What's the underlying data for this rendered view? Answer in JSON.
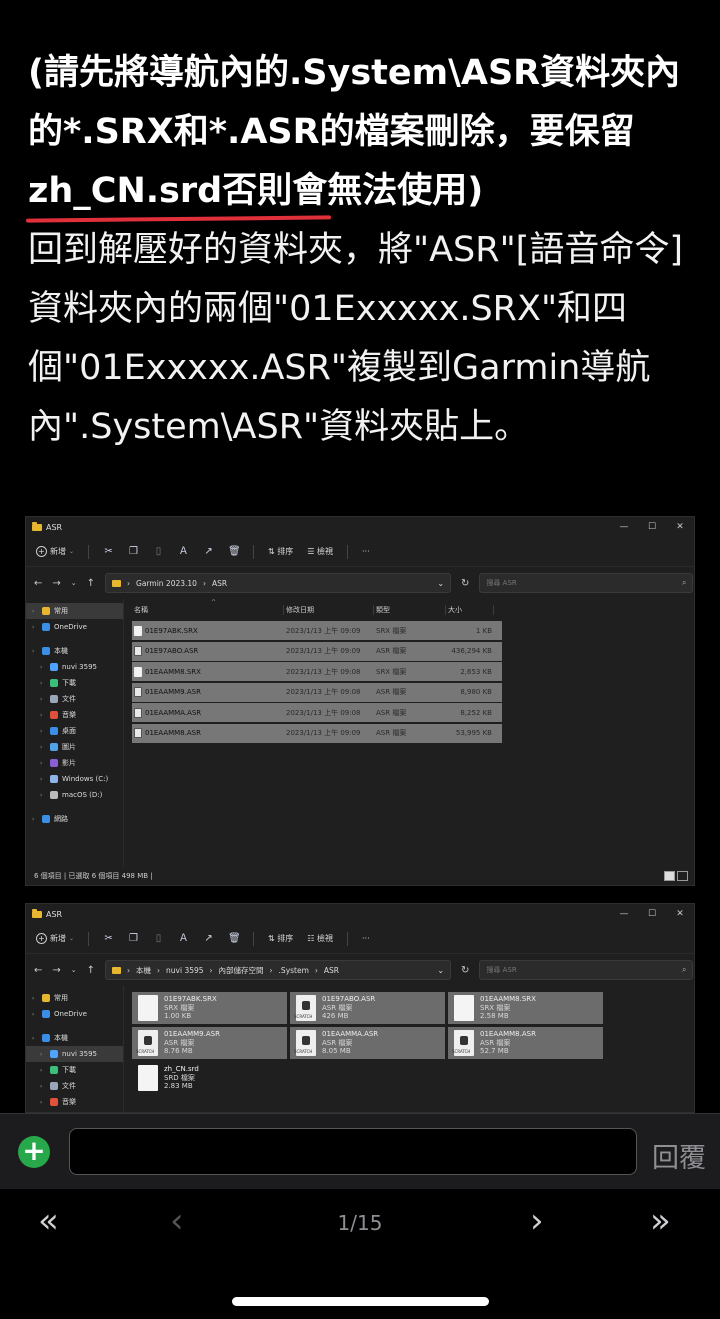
{
  "post": {
    "bold_part1": "(請先將導航內的.System\\ASR資料夾內的*.SRX和*.ASR的檔案刪除，要保留",
    "bold_underlined": "zh_CN.srd否則會",
    "bold_part2": "無法使用)",
    "body": "回到解壓好的資料夾，將\"ASR\"[語音命令]資料夾內的兩個\"01Exxxxx.SRX\"和四個\"01Exxxxx.ASR\"複製到Garmin導航內\".System\\ASR\"資料夾貼上。"
  },
  "explorer1": {
    "window_title": "ASR",
    "win_buttons": [
      "—",
      "☐",
      "✕"
    ],
    "cmd": {
      "new": "新增",
      "sort": "排序",
      "view": "檢視",
      "more": "···"
    },
    "breadcrumb": [
      "Garmin 2023.10",
      "ASR"
    ],
    "search_placeholder": "搜尋 ASR",
    "nav": [
      {
        "label": "常用",
        "color": "#e8b730",
        "level": 1,
        "selected": true
      },
      {
        "label": "OneDrive",
        "color": "#3b8ee6",
        "level": 1
      },
      {
        "label": "本機",
        "color": "#3b8ee6",
        "level": 1
      },
      {
        "label": "nuvi 3595",
        "color": "#4da3ff",
        "level": 2
      },
      {
        "label": "下載",
        "color": "#3bbf7a",
        "level": 2
      },
      {
        "label": "文件",
        "color": "#9aa7b8",
        "level": 2
      },
      {
        "label": "音樂",
        "color": "#e0503a",
        "level": 2
      },
      {
        "label": "桌面",
        "color": "#3b8ee6",
        "level": 2
      },
      {
        "label": "圖片",
        "color": "#4fa3e8",
        "level": 2
      },
      {
        "label": "影片",
        "color": "#8a5fd6",
        "level": 2
      },
      {
        "label": "Windows (C:)",
        "color": "#8fb5e8",
        "level": 2
      },
      {
        "label": "macOS (D:)",
        "color": "#bbbbbb",
        "level": 2
      },
      {
        "label": "網路",
        "color": "#3b8ee6",
        "level": 1
      }
    ],
    "columns": {
      "name": "名稱",
      "date": "修改日期",
      "type": "類型",
      "size": "大小"
    },
    "rows": [
      {
        "name": "01E97ABK.SRX",
        "date": "2023/1/13 上午 09:09",
        "type": "SRX 檔案",
        "size": "1 KB"
      },
      {
        "name": "01E97ABO.ASR",
        "date": "2023/1/13 上午 09:09",
        "type": "ASR 檔案",
        "size": "436,294 KB"
      },
      {
        "name": "01EAAMM8.SRX",
        "date": "2023/1/13 上午 09:08",
        "type": "SRX 檔案",
        "size": "2,653 KB"
      },
      {
        "name": "01EAAMM9.ASR",
        "date": "2023/1/13 上午 09:08",
        "type": "ASR 檔案",
        "size": "8,980 KB"
      },
      {
        "name": "01EAAMMA.ASR",
        "date": "2023/1/13 上午 09:08",
        "type": "ASR 檔案",
        "size": "8,252 KB"
      },
      {
        "name": "01EAAMM8.ASR",
        "date": "2023/1/13 上午 09:09",
        "type": "ASR 檔案",
        "size": "53,995 KB"
      }
    ],
    "status": "6 個項目  |  已選取 6 個項目 498 MB  |"
  },
  "explorer2": {
    "window_title": "ASR",
    "cmd": {
      "new": "新增",
      "sort": "排序",
      "view": "檢視",
      "more": "···"
    },
    "breadcrumb": [
      "本機",
      "nuvi 3595",
      "內部儲存空間",
      ".System",
      "ASR"
    ],
    "search_placeholder": "搜尋 ASR",
    "nav": [
      {
        "label": "常用",
        "color": "#e8b730",
        "level": 1
      },
      {
        "label": "OneDrive",
        "color": "#3b8ee6",
        "level": 1
      },
      {
        "label": "本機",
        "color": "#3b8ee6",
        "level": 1
      },
      {
        "label": "nuvi 3595",
        "color": "#4da3ff",
        "level": 2,
        "selected": true
      },
      {
        "label": "下載",
        "color": "#3bbf7a",
        "level": 2
      },
      {
        "label": "文件",
        "color": "#9aa7b8",
        "level": 2
      },
      {
        "label": "音樂",
        "color": "#e0503a",
        "level": 2
      }
    ],
    "tiles": [
      {
        "name": "01E97ABK.SRX",
        "type": "SRX 檔案",
        "size": "1.00 KB",
        "icon": "doc",
        "selected": true
      },
      {
        "name": "01E97ABO.ASR",
        "type": "ASR 檔案",
        "size": "426 MB",
        "icon": "scratch",
        "selected": true
      },
      {
        "name": "01EAAMM8.SRX",
        "type": "SRX 檔案",
        "size": "2.58 MB",
        "icon": "doc",
        "selected": true
      },
      {
        "name": "01EAAMM9.ASR",
        "type": "ASR 檔案",
        "size": "8.76 MB",
        "icon": "scratch",
        "selected": true
      },
      {
        "name": "01EAAMMA.ASR",
        "type": "ASR 檔案",
        "size": "8.05 MB",
        "icon": "scratch",
        "selected": true
      },
      {
        "name": "01EAAMM8.ASR",
        "type": "ASR 檔案",
        "size": "52.7 MB",
        "icon": "scratch",
        "selected": true
      },
      {
        "name": "zh_CN.srd",
        "type": "SRD 檔案",
        "size": "2.83 MB",
        "icon": "doc",
        "selected": false
      }
    ]
  },
  "reply": {
    "placeholder": "",
    "button": "回覆"
  },
  "pager": {
    "first": "«",
    "prev": "‹",
    "page": "1/15",
    "next": "›",
    "last": "»"
  }
}
